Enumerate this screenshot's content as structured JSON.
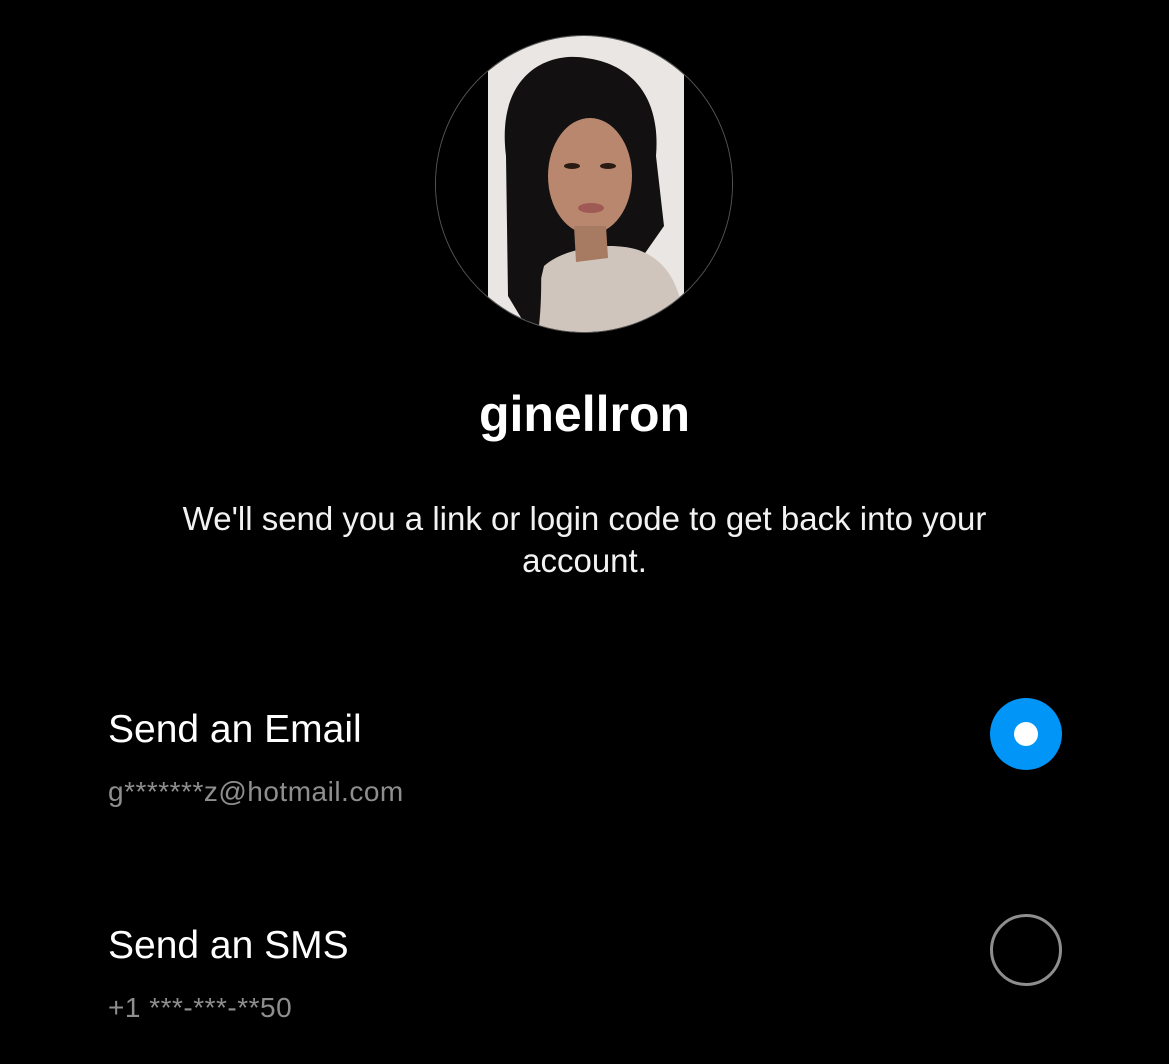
{
  "profile": {
    "username": "ginellron",
    "avatar_icon": "profile-photo"
  },
  "message": "We'll send you a link or login code to get back into your account.",
  "options": [
    {
      "title": "Send an Email",
      "detail": "g*******z@hotmail.com",
      "selected": true
    },
    {
      "title": "Send an SMS",
      "detail": "+1 ***-***-**50",
      "selected": false
    }
  ],
  "colors": {
    "accent": "#0095f6",
    "background": "#000000",
    "muted_text": "#8e8e8e"
  }
}
